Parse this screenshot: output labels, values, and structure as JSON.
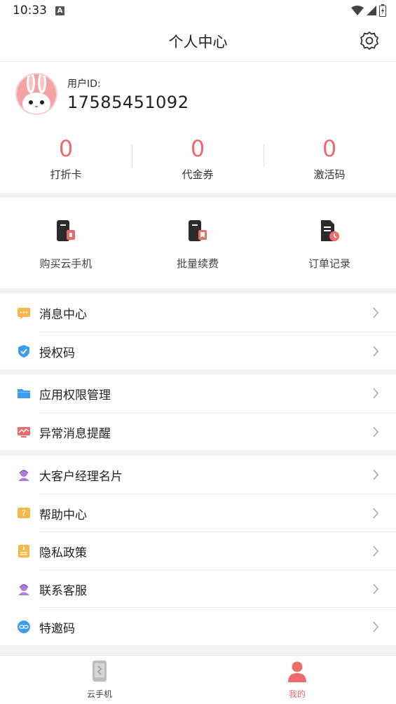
{
  "status_bar": {
    "time": "10:33",
    "notification_letter": "A"
  },
  "header": {
    "title": "个人中心",
    "settings_icon": "gear-icon"
  },
  "profile": {
    "avatar_icon": "rabbit-avatar",
    "uid_label": "用户ID:",
    "uid_value": "17585451092"
  },
  "stats": [
    {
      "value": "0",
      "label": "打折卡"
    },
    {
      "value": "0",
      "label": "代金券"
    },
    {
      "value": "0",
      "label": "激活码"
    }
  ],
  "actions": [
    {
      "label": "购买云手机",
      "icon": "phone-buy-icon"
    },
    {
      "label": "批量续费",
      "icon": "phone-renew-icon"
    },
    {
      "label": "订单记录",
      "icon": "order-record-icon"
    }
  ],
  "menu_groups": [
    [
      {
        "label": "消息中心",
        "icon": "message-icon",
        "color": "#f7b84b"
      },
      {
        "label": "授权码",
        "icon": "shield-icon",
        "color": "#3d9cf0"
      }
    ],
    [
      {
        "label": "应用权限管理",
        "icon": "folder-icon",
        "color": "#3d9cf0"
      },
      {
        "label": "异常消息提醒",
        "icon": "alert-chart-icon",
        "color": "#ec6b6b"
      }
    ],
    [
      {
        "label": "大客户经理名片",
        "icon": "manager-icon",
        "color": "#b07be0"
      },
      {
        "label": "帮助中心",
        "icon": "help-icon",
        "color": "#f7b84b"
      },
      {
        "label": "隐私政策",
        "icon": "privacy-icon",
        "color": "#f7b84b"
      },
      {
        "label": "联系客服",
        "icon": "service-icon",
        "color": "#b07be0"
      },
      {
        "label": "特邀码",
        "icon": "invite-link-icon",
        "color": "#3d9cf0"
      }
    ]
  ],
  "tabbar": [
    {
      "label": "云手机",
      "icon": "cloud-phone-icon",
      "active": false
    },
    {
      "label": "我的",
      "icon": "user-icon",
      "active": true
    }
  ],
  "colors": {
    "accent": "#ec6b6b",
    "inactive": "#444444",
    "background": "#f2f2f2"
  }
}
